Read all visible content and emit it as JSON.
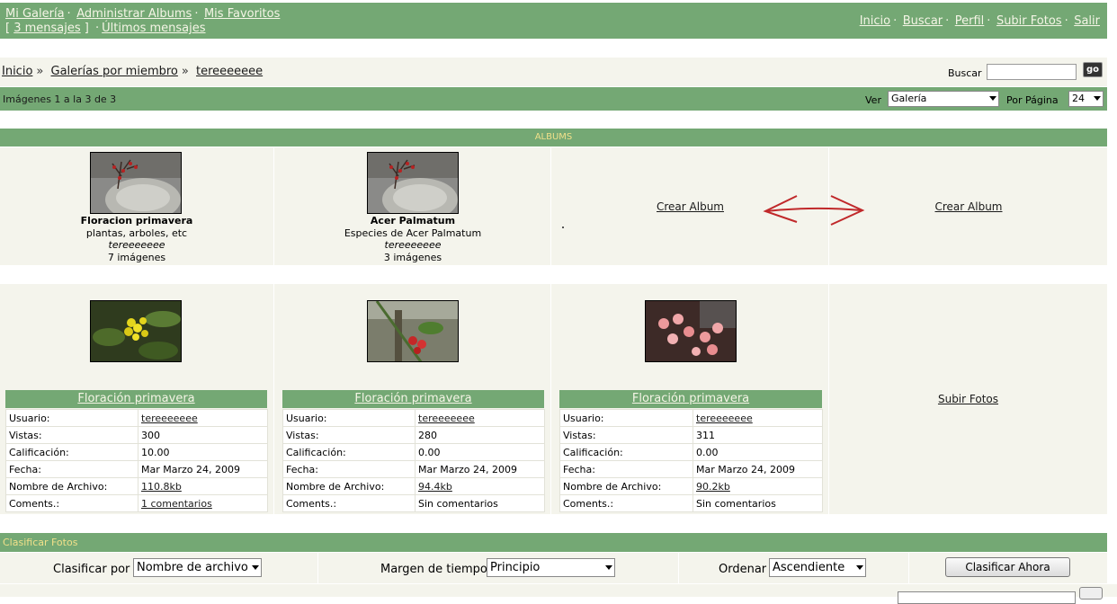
{
  "top_nav": {
    "left_line1": [
      "Mi Galería",
      "Administrar Albums",
      "Mis Favoritos"
    ],
    "messages": "3 mensajes",
    "last_messages": "Últimos mensajes",
    "right": [
      "Inicio",
      "Buscar",
      "Perfil",
      "Subir Fotos",
      "Salir"
    ]
  },
  "breadcrumb": {
    "items": [
      "Inicio",
      "Galerías por miembro",
      "tereeeeeee"
    ],
    "search_label": "Buscar",
    "go_label": "go"
  },
  "info_bar": {
    "count_text": "Imágenes 1 a la 3 de 3",
    "view_label": "Ver",
    "view_value": "Galería",
    "per_page_label": "Por Página",
    "per_page_value": "24"
  },
  "albums": {
    "header": "ALBUMS",
    "items": [
      {
        "title": "Floracion primavera",
        "description": "plantas, arboles, etc",
        "owner": "tereeeeeee",
        "count": "7 imágenes"
      },
      {
        "title": "Acer Palmatum",
        "description": "Especies de Acer Palmatum",
        "owner": "tereeeeeee",
        "count": "3 imágenes"
      }
    ],
    "create_label": "Crear Album"
  },
  "photos": {
    "items": [
      {
        "title": "Floración primavera",
        "user": "tereeeeeee",
        "views": "300",
        "rating": "10.00",
        "date": "Mar Marzo 24, 2009",
        "file": "110.8kb",
        "comments": "1 comentarios"
      },
      {
        "title": "Floración primavera",
        "user": "tereeeeeee",
        "views": "280",
        "rating": "0.00",
        "date": "Mar Marzo 24, 2009",
        "file": "94.4kb",
        "comments": "Sin comentarios"
      },
      {
        "title": "Floración primavera",
        "user": "tereeeeeee",
        "views": "311",
        "rating": "0.00",
        "date": "Mar Marzo 24, 2009",
        "file": "90.2kb",
        "comments": "Sin comentarios"
      }
    ],
    "labels": {
      "user": "Usuario:",
      "views": "Vistas:",
      "rating": "Calificación:",
      "date": "Fecha:",
      "file": "Nombre de Archivo:",
      "comments": "Coments.:"
    },
    "upload_label": "Subir Fotos"
  },
  "sort": {
    "header": "Clasificar Fotos",
    "sort_by_label": "Clasificar  por",
    "sort_by_value": "Nombre de archivo",
    "timeframe_label": "Margen de tiempo",
    "timeframe_value": "Principio",
    "order_label": "Ordenar",
    "order_value": "Ascendiente",
    "submit_label": "Clasificar Ahora"
  },
  "colors": {
    "header_green": "#74a874",
    "panel_bg": "#f4f4ec",
    "header_text_yellow": "#f0e08a",
    "annotation_red": "#c0282a"
  },
  "annotation": {
    "icon": "double-headed-arrow"
  }
}
